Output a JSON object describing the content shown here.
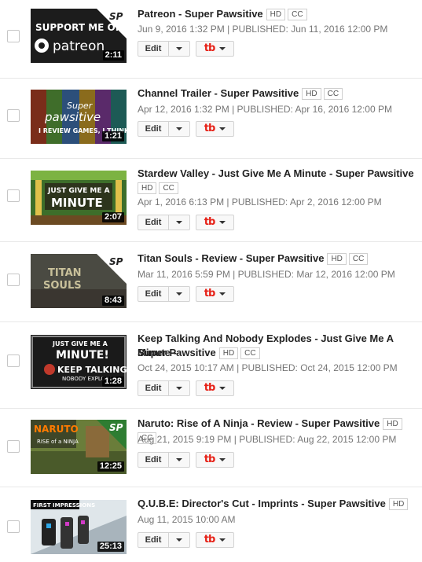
{
  "ui": {
    "edit_label": "Edit",
    "hd": "HD",
    "cc": "CC"
  },
  "colors": {
    "accent_red": "#e62117",
    "text": "#222222",
    "meta": "#767676"
  },
  "videos": [
    {
      "title": "Patreon - Super Pawsitive",
      "date_line": "Jun 9, 2016 1:32 PM | PUBLISHED: Jun 11, 2016 12:00 PM",
      "duration": "2:11",
      "thumb_text": "SUPPORT ME ON patreon"
    },
    {
      "title": "Channel Trailer - Super Pawsitive",
      "date_line": "Apr 12, 2016 1:32 PM | PUBLISHED: Apr 16, 2016 12:00 PM",
      "duration": "1:21",
      "thumb_text": "Super Pawsitive I REVIEW GAMES, I THINK"
    },
    {
      "title": "Stardew Valley - Just Give Me A Minute - Super Pawsitive",
      "date_line": "Apr 1, 2016 6:13 PM | PUBLISHED: Apr 2, 2016 12:00 PM",
      "duration": "2:07",
      "thumb_text": "JUST GIVE ME A MINUTE"
    },
    {
      "title": "Titan Souls - Review - Super Pawsitive",
      "date_line": "Mar 11, 2016 5:59 PM | PUBLISHED: Mar 12, 2016 12:00 PM",
      "duration": "8:43",
      "thumb_text": "TITAN SOULS"
    },
    {
      "title": "Keep Talking And Nobody Explodes - Just Give Me A Minute -",
      "title2": "Super Pawsitive",
      "date_line": "Oct 24, 2015 10:17 AM | PUBLISHED: Oct 24, 2015 12:00 PM",
      "duration": "1:28",
      "thumb_text": "JUST GIVE ME A MINUTE! KEEP TALKING NOBODY EXPLODES"
    },
    {
      "title": "Naruto: Rise of A Ninja - Review - Super Pawsitive",
      "date_line": "Aug 21, 2015 9:19 PM | PUBLISHED: Aug 22, 2015 12:00 PM",
      "duration": "12:25",
      "thumb_text": "NARUTO RISE of a NINJA"
    },
    {
      "title": "Q.U.B.E: Director's Cut - Imprints - Super Pawsitive",
      "date_line": "Aug 11, 2015 10:00 AM",
      "duration": "25:13",
      "thumb_text": "FIRST IMPRESSIONS"
    }
  ]
}
